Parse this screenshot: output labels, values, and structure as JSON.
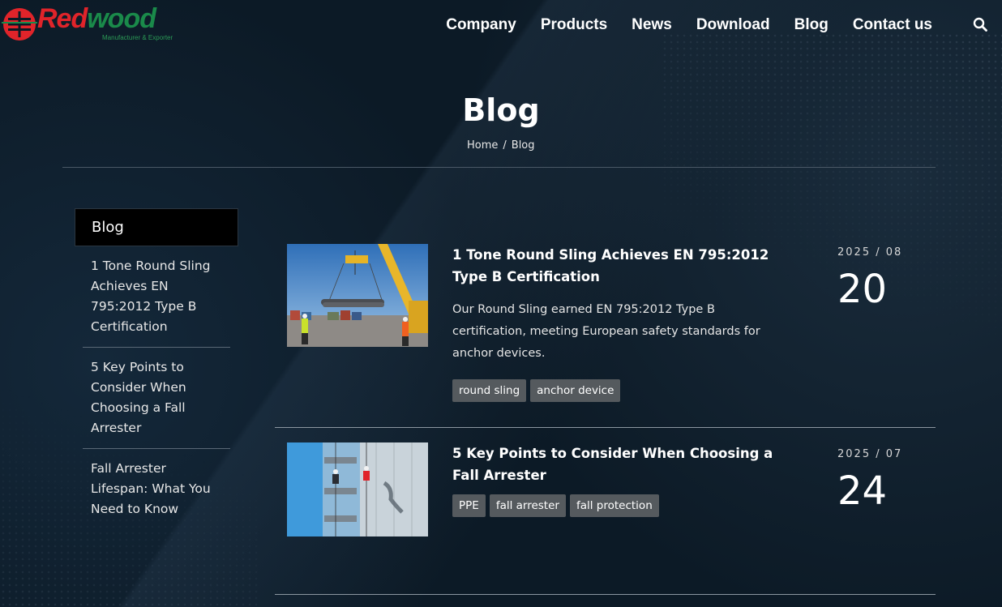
{
  "brand": {
    "word_red": "Red",
    "word_green": "wood",
    "tagline": "Manufacturer & Exporter",
    "colors": {
      "red": "#e0242a",
      "green": "#1a8a4a"
    }
  },
  "nav": {
    "items": [
      "Company",
      "Products",
      "News",
      "Download",
      "Blog",
      "Contact us"
    ],
    "search_icon": "search-icon"
  },
  "page": {
    "title": "Blog",
    "breadcrumb": {
      "home": "Home",
      "sep": "/",
      "current": "Blog"
    }
  },
  "sidebar": {
    "title": "Blog",
    "items": [
      "1 Tone Round Sling Achieves EN 795:2012 Type B Certification",
      "5 Key Points to Consider When Choosing a Fall Arrester",
      "Fall Arrester Lifespan: What You Need to Know"
    ]
  },
  "posts": [
    {
      "title": "1 Tone Round Sling Achieves EN 795:2012 Type B Certification",
      "excerpt": "Our Round Sling earned EN 795:2012 Type B certification, meeting European safety standards for anchor devices.",
      "tags": [
        "round sling",
        "anchor device"
      ],
      "year_month": "2025 / 08",
      "day": "20"
    },
    {
      "title": "5 Key Points to Consider When Choosing a Fall Arrester",
      "excerpt": "",
      "tags": [
        "PPE",
        "fall arrester",
        "fall protection"
      ],
      "year_month": "2025 / 07",
      "day": "24"
    }
  ]
}
